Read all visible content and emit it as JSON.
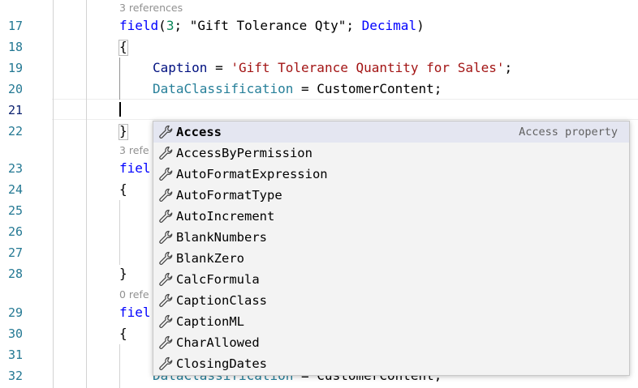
{
  "gutter": {
    "line_numbers": [
      "17",
      "18",
      "19",
      "20",
      "21",
      "22",
      "23",
      "24",
      "25",
      "26",
      "27",
      "28",
      "29",
      "30",
      "31",
      "32"
    ]
  },
  "codelens": {
    "refs_1": "3 references",
    "refs_2": "3 refe",
    "refs_3": "0 refe"
  },
  "code": {
    "l17_field": "field",
    "l17_open": "(",
    "l17_num": "3",
    "l17_sep": "; ",
    "l17_str": "\"Gift Tolerance Qty\"",
    "l17_sep2": "; ",
    "l17_type": "Decimal",
    "l17_close": ")",
    "l18": "{",
    "l19_prop": "Caption",
    "l19_eq": " = ",
    "l19_str": "'Gift Tolerance Quantity for Sales'",
    "l19_semi": ";",
    "l20_prop": "DataClassification",
    "l20_eq": " = ",
    "l20_val": "CustomerContent;",
    "l22": "}",
    "l23": "fiel",
    "l24": "{",
    "l28": "}",
    "l29": "fiel",
    "l30": "{",
    "l32_prop": "DataClassification",
    "l32_eq": " = ",
    "l32_val": "CustomerContent;"
  },
  "suggest": {
    "items": [
      {
        "label": "Access",
        "detail": "Access property"
      },
      {
        "label": "AccessByPermission"
      },
      {
        "label": "AutoFormatExpression"
      },
      {
        "label": "AutoFormatType"
      },
      {
        "label": "AutoIncrement"
      },
      {
        "label": "BlankNumbers"
      },
      {
        "label": "BlankZero"
      },
      {
        "label": "CalcFormula"
      },
      {
        "label": "CaptionClass"
      },
      {
        "label": "CaptionML"
      },
      {
        "label": "CharAllowed"
      },
      {
        "label": "ClosingDates"
      }
    ],
    "icon": "wrench-icon"
  },
  "colors": {
    "line_number": "#237893",
    "keyword": "#001080",
    "string": "#a31515",
    "type": "#0000ff",
    "number": "#098658",
    "selected_bg": "#e4e6f1"
  }
}
